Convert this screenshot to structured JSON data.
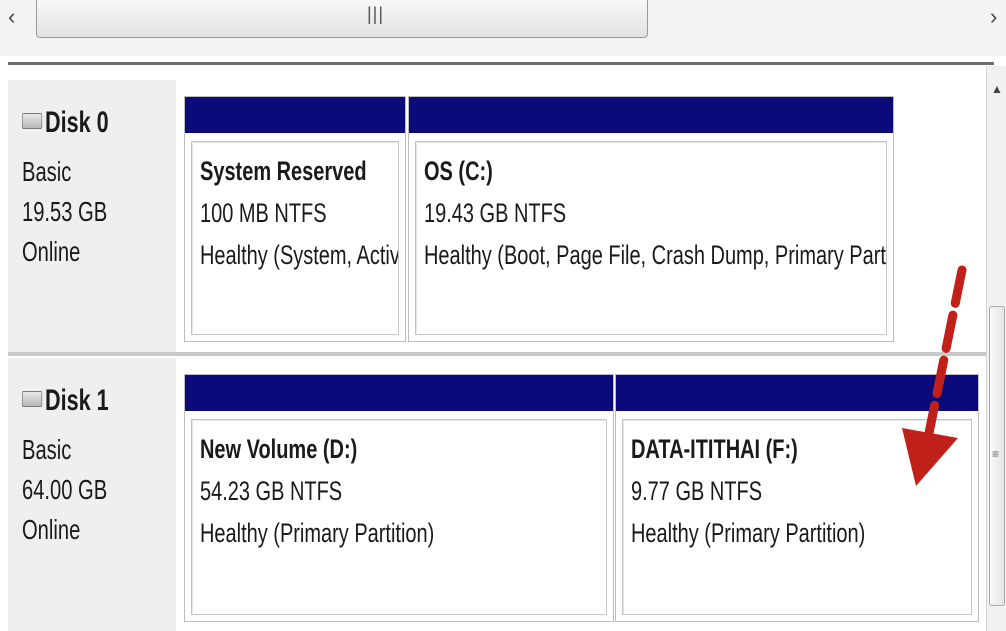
{
  "scrollbar": {
    "left_arrow": "‹",
    "right_arrow": "›",
    "grip": "|||",
    "up_arrow": "▲",
    "vgrip": "≡"
  },
  "disks": [
    {
      "name": "Disk 0",
      "type": "Basic",
      "size": "19.53 GB",
      "status": "Online",
      "partitions": [
        {
          "title": "System Reserved",
          "fs": "100 MB NTFS",
          "status": "Healthy (System, Activ"
        },
        {
          "title": "OS  (C:)",
          "fs": "19.43 GB NTFS",
          "status": "Healthy (Boot, Page File, Crash Dump, Primary Parti"
        }
      ]
    },
    {
      "name": "Disk 1",
      "type": "Basic",
      "size": "64.00 GB",
      "status": "Online",
      "partitions": [
        {
          "title": "New Volume  (D:)",
          "fs": "54.23 GB NTFS",
          "status": "Healthy (Primary Partition)"
        },
        {
          "title": "DATA-ITITHAI  (F:)",
          "fs": "9.77 GB NTFS",
          "status": "Healthy (Primary Partition)"
        }
      ]
    }
  ],
  "colors": {
    "partition_bar": "#0a0a7a",
    "annotation_arrow": "#c0201a"
  }
}
